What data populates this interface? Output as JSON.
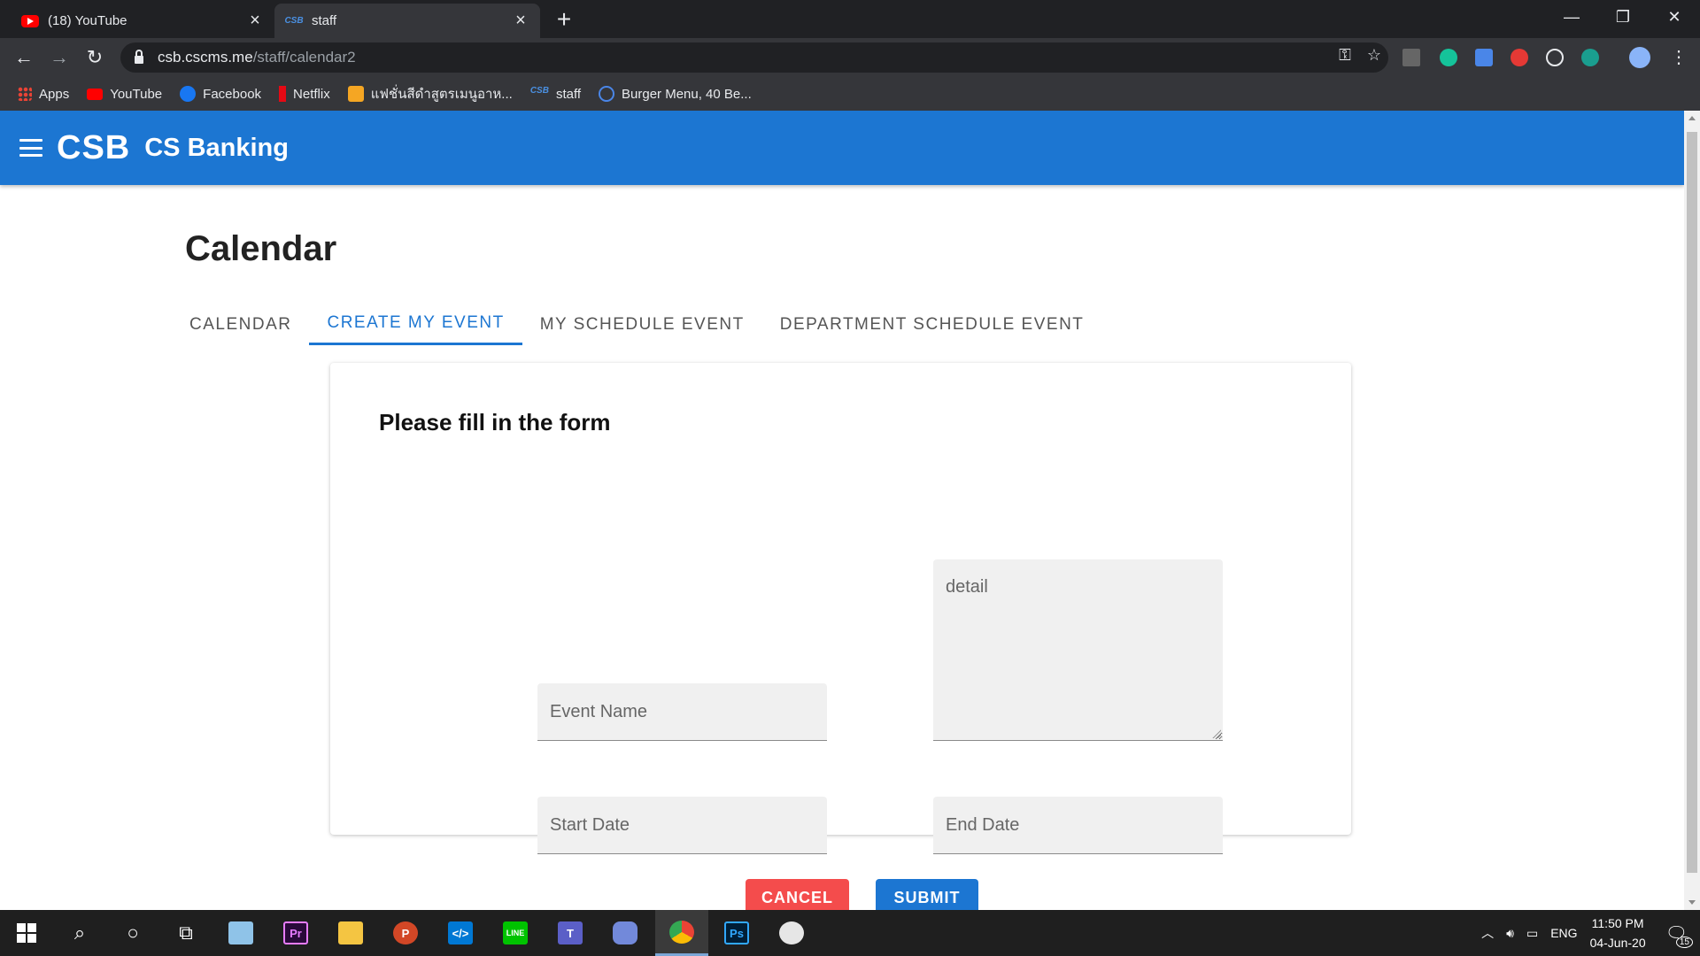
{
  "browser": {
    "tabs": [
      {
        "title": "(18) YouTube",
        "favicon": "youtube-icon"
      },
      {
        "title": "staff",
        "favicon": "csb-icon",
        "favicon_text": "CSB",
        "active": true
      }
    ],
    "url_host": "csb.cscms.me",
    "url_path": "/staff/calendar2",
    "bookmarks": [
      {
        "label": "Apps",
        "icon": "apps-grid-icon"
      },
      {
        "label": "YouTube",
        "icon": "youtube-icon"
      },
      {
        "label": "Facebook",
        "icon": "facebook-icon"
      },
      {
        "label": "Netflix",
        "icon": "netflix-icon"
      },
      {
        "label": "แฟชั่นสีดำสูตรเมนูอาห...",
        "icon": "bookmark-p-icon"
      },
      {
        "label": "staff",
        "icon": "csb-icon"
      },
      {
        "label": "Burger Menu, 40 Be...",
        "icon": "gear-icon"
      }
    ]
  },
  "app": {
    "logo": "CSB",
    "name": "CS Banking",
    "accent": "#1c76d2"
  },
  "page": {
    "title": "Calendar",
    "tabs": [
      {
        "label": "CALENDAR"
      },
      {
        "label": "CREATE MY EVENT",
        "active": true
      },
      {
        "label": "MY SCHEDULE EVENT"
      },
      {
        "label": "DEPARTMENT SCHEDULE EVENT"
      }
    ]
  },
  "form": {
    "heading": "Please fill in the form",
    "event_name_placeholder": "Event Name",
    "detail_placeholder": "detail",
    "start_date_placeholder": "Start Date",
    "end_date_placeholder": "End Date",
    "cancel_label": "CANCEL",
    "submit_label": "SUBMIT",
    "cancel_color": "#f44c4c",
    "submit_color": "#1c76d2"
  },
  "taskbar": {
    "language": "ENG",
    "time": "11:50 PM",
    "date": "04-Jun-20",
    "notification_count": "15",
    "apps": [
      "windows-start-icon",
      "search-icon",
      "cortana-icon",
      "task-view-icon",
      "notepad-icon",
      "premiere-icon",
      "file-explorer-icon",
      "powerpoint-icon",
      "vscode-icon",
      "line-icon",
      "teams-icon",
      "discord-icon",
      "chrome-icon",
      "photoshop-icon",
      "paint-icon"
    ]
  }
}
